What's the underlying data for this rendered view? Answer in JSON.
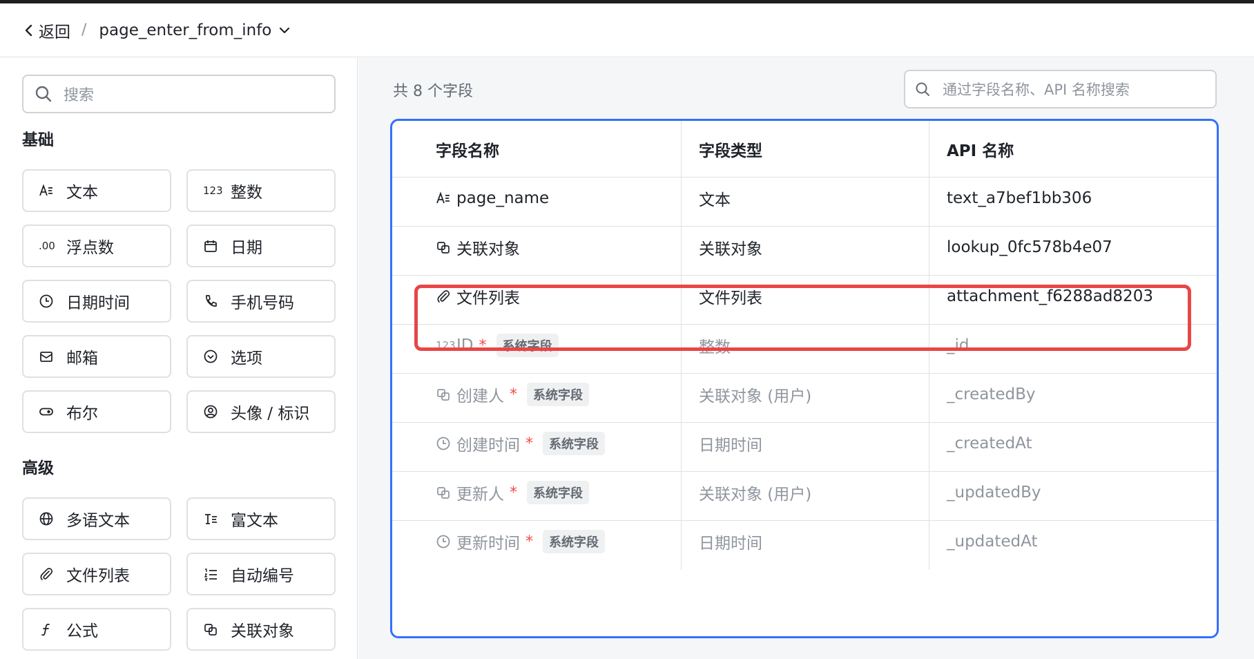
{
  "header": {
    "back_label": "返回",
    "separator": "/",
    "title": "page_enter_from_info"
  },
  "sidebar": {
    "search_placeholder": "搜索",
    "basic_title": "基础",
    "basic_items": [
      {
        "label": "文本",
        "icon": "text-icon"
      },
      {
        "label": "整数",
        "icon": "integer-icon",
        "glyph": "123"
      },
      {
        "label": "浮点数",
        "icon": "decimal-icon",
        "glyph": ".00"
      },
      {
        "label": "日期",
        "icon": "calendar-icon"
      },
      {
        "label": "日期时间",
        "icon": "clock-icon"
      },
      {
        "label": "手机号码",
        "icon": "phone-icon"
      },
      {
        "label": "邮箱",
        "icon": "mail-icon"
      },
      {
        "label": "选项",
        "icon": "option-icon"
      },
      {
        "label": "布尔",
        "icon": "toggle-icon"
      },
      {
        "label": "头像 / 标识",
        "icon": "avatar-icon"
      }
    ],
    "advanced_title": "高级",
    "advanced_items": [
      {
        "label": "多语文本",
        "icon": "globe-icon"
      },
      {
        "label": "富文本",
        "icon": "rich-text-icon"
      },
      {
        "label": "文件列表",
        "icon": "attachment-icon"
      },
      {
        "label": "自动编号",
        "icon": "list-number-icon"
      },
      {
        "label": "公式",
        "icon": "formula-icon"
      },
      {
        "label": "关联对象",
        "icon": "lookup-icon"
      }
    ]
  },
  "main": {
    "count_label": "共 8 个字段",
    "search_placeholder": "通过字段名称、API 名称搜索",
    "columns": [
      "字段名称",
      "字段类型",
      "API 名称"
    ],
    "rows": [
      {
        "name": "page_name",
        "type": "文本",
        "api": "text_a7bef1bb306",
        "icon": "text-icon",
        "system": false,
        "required": false
      },
      {
        "name": "关联对象",
        "type": "关联对象",
        "api": "lookup_0fc578b4e07",
        "icon": "lookup-icon",
        "system": false,
        "required": false
      },
      {
        "name": "文件列表",
        "type": "文件列表",
        "api": "attachment_f6288ad8203",
        "icon": "attachment-icon",
        "system": false,
        "required": false,
        "highlighted": true
      },
      {
        "name": "ID",
        "type": "整数",
        "api": "_id",
        "icon": "integer-icon",
        "glyph": "123",
        "system": true,
        "required": true,
        "badge": "系统字段"
      },
      {
        "name": "创建人",
        "type": "关联对象 (用户)",
        "api": "_createdBy",
        "icon": "lookup-icon",
        "system": true,
        "required": true,
        "badge": "系统字段"
      },
      {
        "name": "创建时间",
        "type": "日期时间",
        "api": "_createdAt",
        "icon": "clock-icon",
        "system": true,
        "required": true,
        "badge": "系统字段"
      },
      {
        "name": "更新人",
        "type": "关联对象 (用户)",
        "api": "_updatedBy",
        "icon": "lookup-icon",
        "system": true,
        "required": true,
        "badge": "系统字段"
      },
      {
        "name": "更新时间",
        "type": "日期时间",
        "api": "_updatedAt",
        "icon": "clock-icon",
        "system": true,
        "required": true,
        "badge": "系统字段"
      }
    ],
    "required_mark": "*"
  },
  "colors": {
    "accent_blue": "#3370ff",
    "highlight_red": "#e84646",
    "required_red": "#f54a45",
    "muted_text": "#8f959e"
  }
}
